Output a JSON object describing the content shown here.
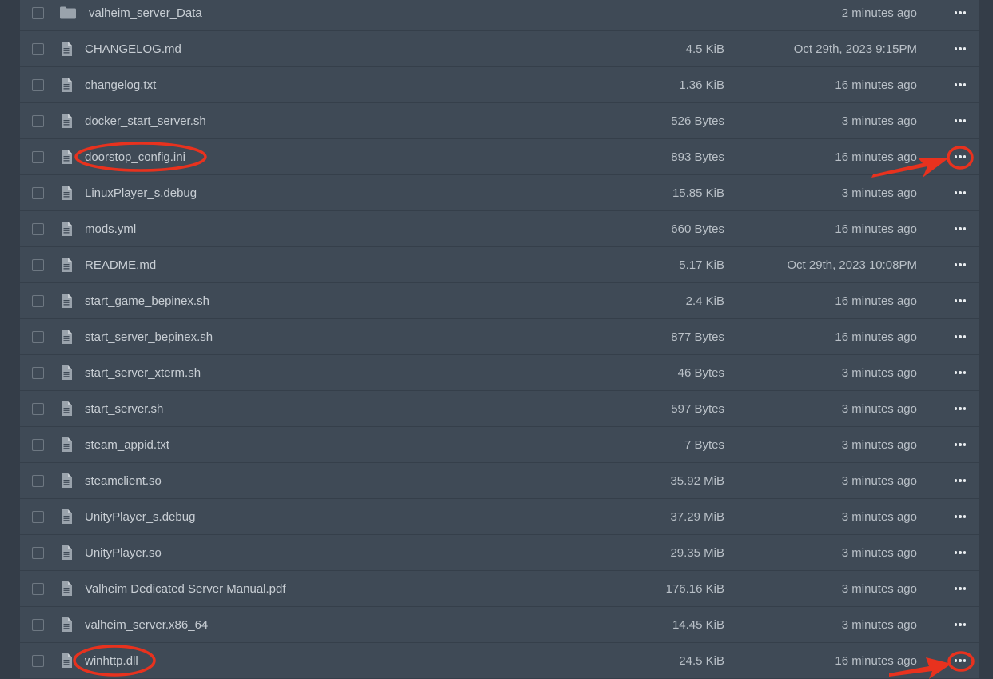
{
  "files": [
    {
      "name": "valheim_server_Data",
      "size": "",
      "modified": "2 minutes ago",
      "type": "folder",
      "icon": "folder-icon"
    },
    {
      "name": "CHANGELOG.md",
      "size": "4.5 KiB",
      "modified": "Oct 29th, 2023 9:15PM",
      "type": "file",
      "icon": "file-icon"
    },
    {
      "name": "changelog.txt",
      "size": "1.36 KiB",
      "modified": "16 minutes ago",
      "type": "file",
      "icon": "file-icon"
    },
    {
      "name": "docker_start_server.sh",
      "size": "526 Bytes",
      "modified": "3 minutes ago",
      "type": "file",
      "icon": "file-icon"
    },
    {
      "name": "doorstop_config.ini",
      "size": "893 Bytes",
      "modified": "16 minutes ago",
      "type": "file",
      "icon": "file-icon"
    },
    {
      "name": "LinuxPlayer_s.debug",
      "size": "15.85 KiB",
      "modified": "3 minutes ago",
      "type": "file",
      "icon": "file-icon"
    },
    {
      "name": "mods.yml",
      "size": "660 Bytes",
      "modified": "16 minutes ago",
      "type": "file",
      "icon": "file-icon"
    },
    {
      "name": "README.md",
      "size": "5.17 KiB",
      "modified": "Oct 29th, 2023 10:08PM",
      "type": "file",
      "icon": "file-icon"
    },
    {
      "name": "start_game_bepinex.sh",
      "size": "2.4 KiB",
      "modified": "16 minutes ago",
      "type": "file",
      "icon": "file-icon"
    },
    {
      "name": "start_server_bepinex.sh",
      "size": "877 Bytes",
      "modified": "16 minutes ago",
      "type": "file",
      "icon": "file-icon"
    },
    {
      "name": "start_server_xterm.sh",
      "size": "46 Bytes",
      "modified": "3 minutes ago",
      "type": "file",
      "icon": "file-icon"
    },
    {
      "name": "start_server.sh",
      "size": "597 Bytes",
      "modified": "3 minutes ago",
      "type": "file",
      "icon": "file-icon"
    },
    {
      "name": "steam_appid.txt",
      "size": "7 Bytes",
      "modified": "3 minutes ago",
      "type": "file",
      "icon": "file-icon"
    },
    {
      "name": "steamclient.so",
      "size": "35.92 MiB",
      "modified": "3 minutes ago",
      "type": "file",
      "icon": "file-icon"
    },
    {
      "name": "UnityPlayer_s.debug",
      "size": "37.29 MiB",
      "modified": "3 minutes ago",
      "type": "file",
      "icon": "file-icon"
    },
    {
      "name": "UnityPlayer.so",
      "size": "29.35 MiB",
      "modified": "3 minutes ago",
      "type": "file",
      "icon": "file-icon"
    },
    {
      "name": "Valheim Dedicated Server Manual.pdf",
      "size": "176.16 KiB",
      "modified": "3 minutes ago",
      "type": "file",
      "icon": "file-icon"
    },
    {
      "name": "valheim_server.x86_64",
      "size": "14.45 KiB",
      "modified": "3 minutes ago",
      "type": "file",
      "icon": "file-icon"
    },
    {
      "name": "winhttp.dll",
      "size": "24.5 KiB",
      "modified": "16 minutes ago",
      "type": "file",
      "icon": "file-icon"
    }
  ],
  "row_actions_icon": "more-horizontal-icon",
  "annotation_color": "#e8321e",
  "colors": {
    "page_background": "#343d48",
    "list_background": "#3f4a56",
    "row_divider": "#353f4a",
    "text": "#c8ced4",
    "muted_text": "#b9c0c7",
    "icon": "#9aa3ac"
  }
}
